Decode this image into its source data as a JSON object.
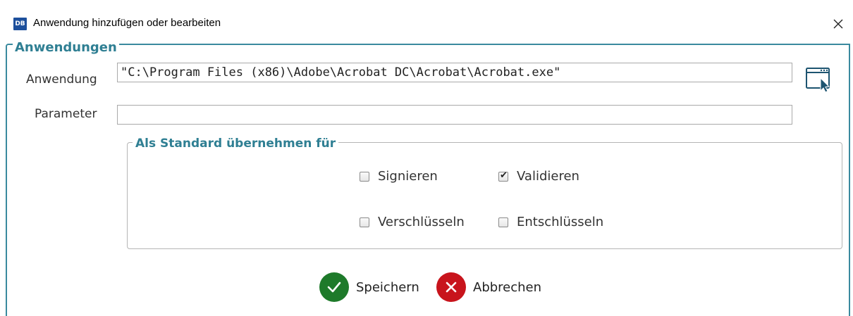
{
  "window": {
    "logo_text": "DB",
    "title": "Anwendung hinzufügen oder bearbeiten",
    "close_icon": "close-icon"
  },
  "section": {
    "legend": "Anwendungen",
    "application": {
      "label": "Anwendung",
      "value": "\"C:\\Program Files (x86)\\Adobe\\Acrobat DC\\Acrobat\\Acrobat.exe\"",
      "browse_icon": "browse-window-cursor-icon"
    },
    "parameter": {
      "label": "Parameter",
      "value": ""
    }
  },
  "defaults": {
    "legend": "Als Standard übernehmen für",
    "options": [
      {
        "label": "Signieren",
        "checked": false
      },
      {
        "label": "Validieren",
        "checked": true
      },
      {
        "label": "Verschlüsseln",
        "checked": false
      },
      {
        "label": "Entschlüsseln",
        "checked": false
      }
    ]
  },
  "actions": {
    "save_label": "Speichern",
    "save_icon": "checkmark-icon",
    "cancel_label": "Abbrechen",
    "cancel_icon": "x-icon"
  },
  "colors": {
    "accent": "#2f7f93",
    "save": "#1e7a2a",
    "cancel": "#c8141c",
    "logo": "#1c4f9c"
  }
}
